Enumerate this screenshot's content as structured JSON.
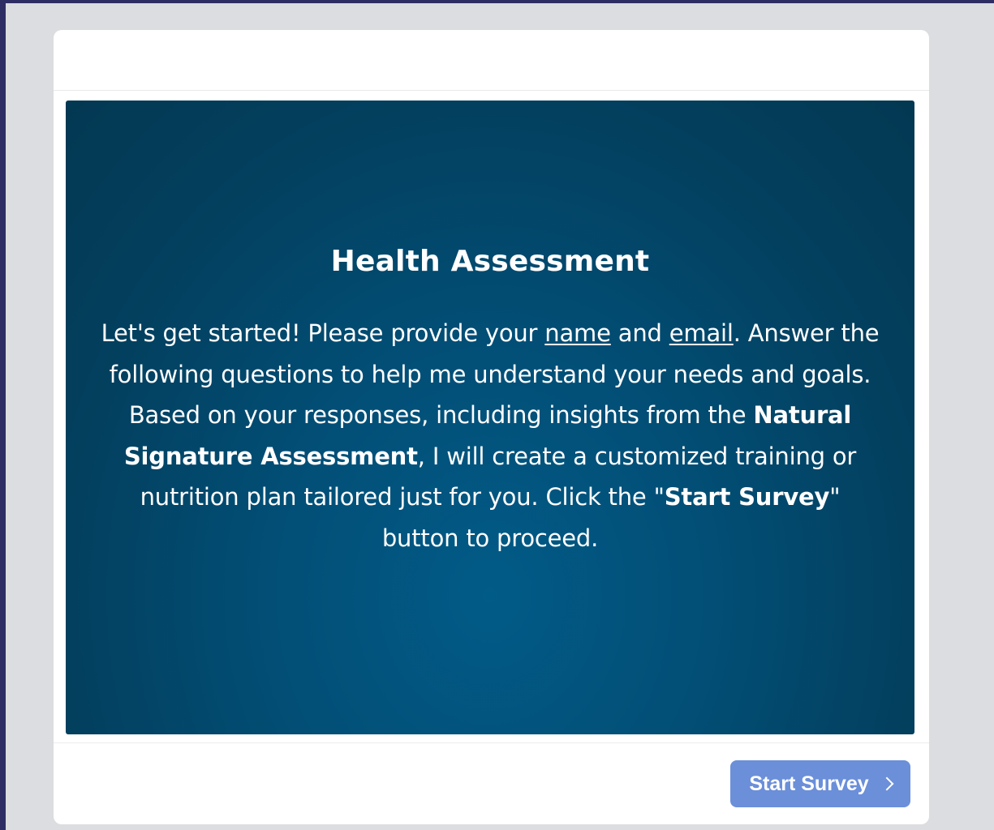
{
  "survey": {
    "title": "Health Assessment",
    "intro": {
      "p1": "Let's get started! Please provide your ",
      "name_link": "name",
      "p2": " and ",
      "email_link": "email",
      "p3": ". Answer the following questions to help me understand your needs and goals. Based on your responses, including insights from the ",
      "bold_assessment": "Natural Signature Assessment",
      "p4": ", I will create a customized training or nutrition plan tailored just for you. Click the \"",
      "bold_button": "Start Survey",
      "p5": "\" button to proceed."
    }
  },
  "footer": {
    "start_label": "Start Survey",
    "start_icon": "chevron-right-icon"
  },
  "colors": {
    "page_bg": "#dcdde0",
    "hero_bg": "#03405f",
    "button_bg": "#6b8fd9",
    "frame_edge": "#2e2d63"
  }
}
